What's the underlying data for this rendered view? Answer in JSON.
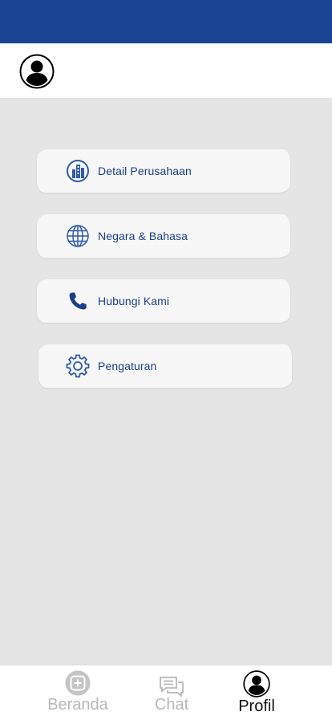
{
  "colors": {
    "status_bar": "#1b4593",
    "accent": "#1b3f86",
    "icon_blue": "#2f5ba8",
    "nav_inactive": "#b8b8b8",
    "nav_active": "#111111",
    "background": "#e5e5e5"
  },
  "header": {
    "avatar_icon": "user-circle-icon"
  },
  "menu": {
    "items": [
      {
        "label": "Detail Perusahaan",
        "icon": "buildings-icon"
      },
      {
        "label": "Negara & Bahasa",
        "icon": "globe-icon"
      },
      {
        "label": "Hubungi Kami",
        "icon": "phone-icon"
      },
      {
        "label": "Pengaturan",
        "icon": "gear-icon"
      }
    ]
  },
  "bottom_nav": {
    "items": [
      {
        "label": "Beranda",
        "icon": "plus-badge-icon",
        "active": false
      },
      {
        "label": "Chat",
        "icon": "chat-bubbles-icon",
        "active": false
      },
      {
        "label": "Profil",
        "icon": "user-circle-icon",
        "active": true
      }
    ]
  }
}
